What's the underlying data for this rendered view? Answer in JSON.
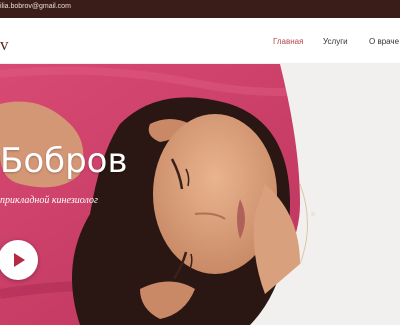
{
  "topbar": {
    "email": "ilia.bobrov@gmail.com"
  },
  "header": {
    "logo": "v",
    "nav": [
      {
        "label": "Главная",
        "active": true
      },
      {
        "label": "Услуги",
        "active": false
      },
      {
        "label": "О враче",
        "active": false
      }
    ]
  },
  "hero": {
    "title": "Бобров",
    "subtitle": "прикладной кинезиолог",
    "play_icon": "play-icon"
  },
  "colors": {
    "topbar": "#3a1d19",
    "nav_active": "#b0484d",
    "play_icon": "#b52a43"
  }
}
